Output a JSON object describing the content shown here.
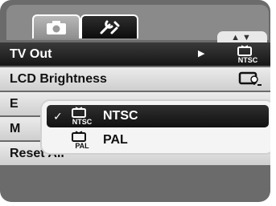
{
  "tabs": [
    {
      "name": "camera",
      "icon": "camera-icon",
      "active": false
    },
    {
      "name": "setup",
      "icon": "wrench-screwdriver-icon",
      "active": true
    }
  ],
  "nav_hint": "▲▼",
  "menu": {
    "rows": [
      {
        "label": "TV Out",
        "selected": true,
        "arrow": "▶",
        "icon": "tv-ntsc-icon",
        "icon_text": "NTSC"
      },
      {
        "label": "LCD Brightness",
        "selected": false,
        "icon": "lcd-brightness-icon"
      },
      {
        "label": "E",
        "selected": false
      },
      {
        "label": "M",
        "selected": false
      },
      {
        "label": "Reset All",
        "selected": false
      }
    ]
  },
  "popup": {
    "options": [
      {
        "check": "✓",
        "icon": "tv-ntsc-icon",
        "icon_text": "NTSC",
        "label": "NTSC",
        "selected": true
      },
      {
        "check": "",
        "icon": "tv-pal-icon",
        "icon_text": "PAL",
        "label": "PAL",
        "selected": false
      }
    ]
  },
  "colors": {
    "selected_bg": "#1a1a1a",
    "row_bg": "#dcdcdc",
    "frame_bg": "#6b6b6b"
  }
}
